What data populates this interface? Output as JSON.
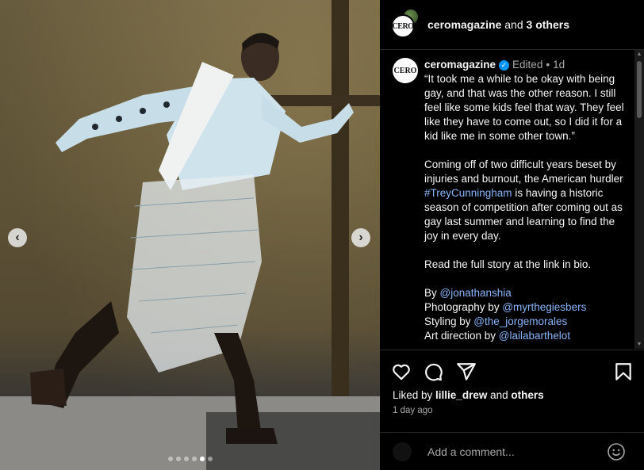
{
  "header": {
    "username": "ceromagazine",
    "joiner": " and ",
    "others": "3 others",
    "logo_text": "CERO"
  },
  "caption": {
    "username": "ceromagazine",
    "edited": "Edited",
    "separator": "•",
    "time": "1d",
    "quote": "“It took me a while to be okay with being gay, and that was the other reason. I still feel like some kids feel that way. They feel like they have to come out, so I did it for a kid like me in some other town.”",
    "para2_before": "Coming off of two difficult years beset by injuries and burnout, the American hurdler ",
    "para2_hashtag": "#TreyCunningham",
    "para2_after": " is having a historic season of competition after coming out as gay last summer and learning to find the joy in every day.",
    "para3": "Read the full story at the link in bio.",
    "credits": [
      {
        "label": "By ",
        "handle": "@jonathanshia"
      },
      {
        "label": "Photography by ",
        "handle": "@myrthegiesbers"
      },
      {
        "label": "Styling by ",
        "handle": "@the_jorgemorales"
      },
      {
        "label": "Art direction by ",
        "handle": "@lailabarthelot"
      }
    ]
  },
  "actions": {
    "liked_by_prefix": "Liked by ",
    "liked_by_user": "lillie_drew",
    "liked_by_and": " and ",
    "liked_by_others": "others",
    "date": "1 day ago"
  },
  "comment": {
    "placeholder": "Add a comment..."
  },
  "carousel": {
    "prev": "‹",
    "next": "›",
    "slide_count": 6,
    "active_slide": 5
  },
  "icons": [
    "heart-icon",
    "comment-icon",
    "share-icon",
    "bookmark-icon",
    "emoji-icon",
    "verified-icon"
  ],
  "colors": {
    "link": "#8ab4f8",
    "verified": "#0095f6",
    "background": "#000000"
  }
}
